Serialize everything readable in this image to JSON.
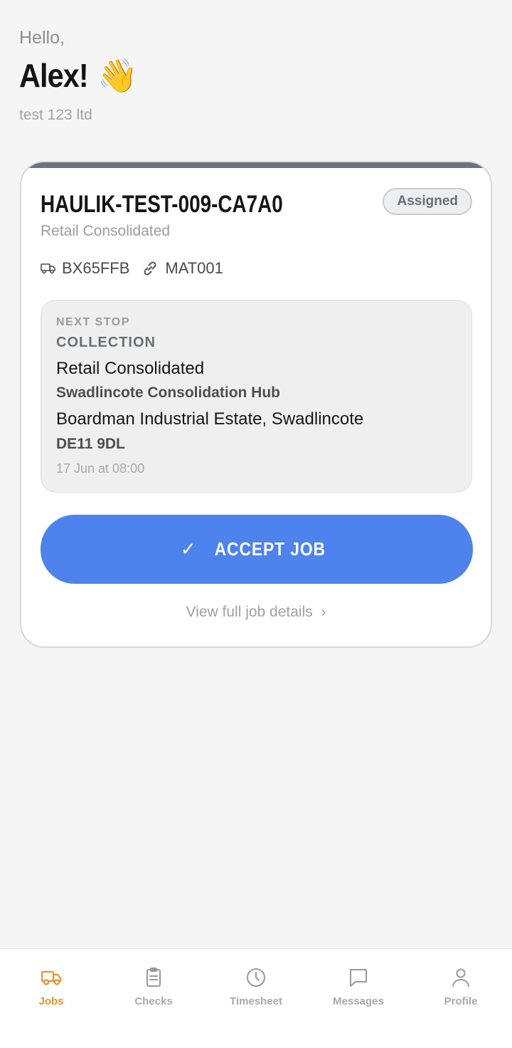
{
  "greeting": {
    "hello": "Hello,",
    "name": "Alex!",
    "emoji": "👋",
    "company": "test 123 ltd"
  },
  "job": {
    "id": "HAULIK-TEST-009-CA7A0",
    "client": "Retail Consolidated",
    "status": "Assigned",
    "vehicle": "BX65FFB",
    "trailer": "MAT001",
    "next_stop": {
      "label": "NEXT STOP",
      "type": "COLLECTION",
      "name": "Retail Consolidated",
      "site": "Swadlincote Consolidation Hub",
      "address": "Boardman Industrial Estate, Swadlincote",
      "postcode": "DE11 9DL",
      "time": "17 Jun at 08:00"
    },
    "accept_label": "ACCEPT JOB",
    "accept_check": "✓",
    "details_label": "View full job details",
    "details_chevron": "›"
  },
  "tabs": [
    {
      "label": "Jobs",
      "icon": "truck-icon",
      "active": true
    },
    {
      "label": "Checks",
      "icon": "clipboard-icon",
      "active": false
    },
    {
      "label": "Timesheet",
      "icon": "clock-icon",
      "active": false
    },
    {
      "label": "Messages",
      "icon": "chat-bubble-icon",
      "active": false
    },
    {
      "label": "Profile",
      "icon": "user-icon",
      "active": false
    }
  ],
  "colors": {
    "accent": "#4e82ec",
    "active_tab": "#e2932c",
    "card_topbar": "#6b7181"
  }
}
